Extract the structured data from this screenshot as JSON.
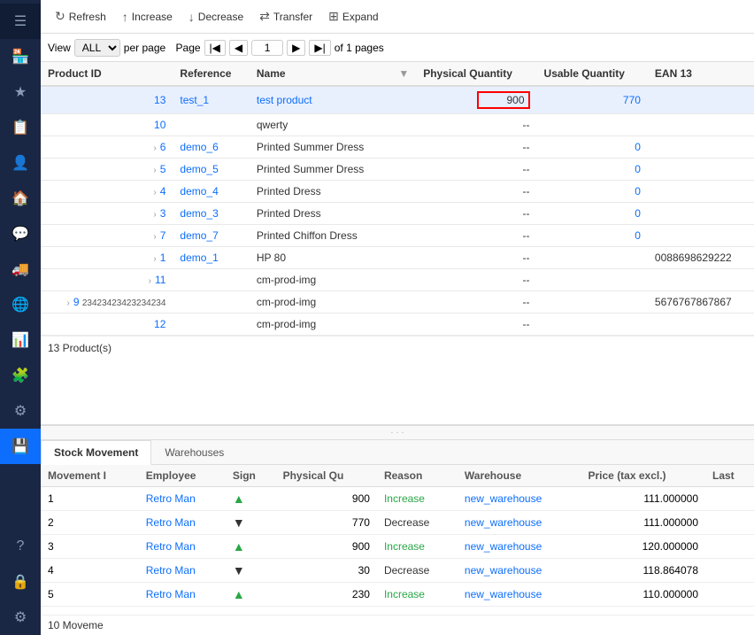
{
  "sidebar": {
    "items": [
      {
        "name": "menu-icon",
        "icon": "☰",
        "active": true
      },
      {
        "name": "store-icon",
        "icon": "🏪"
      },
      {
        "name": "star-icon",
        "icon": "★"
      },
      {
        "name": "clipboard-icon",
        "icon": "📋"
      },
      {
        "name": "user-icon",
        "icon": "👤"
      },
      {
        "name": "home-icon",
        "icon": "🏠"
      },
      {
        "name": "chat-icon",
        "icon": "💬"
      },
      {
        "name": "truck-icon",
        "icon": "🚚"
      },
      {
        "name": "globe-icon",
        "icon": "🌐"
      },
      {
        "name": "chart-icon",
        "icon": "📊"
      },
      {
        "name": "puzzle-icon",
        "icon": "🧩"
      },
      {
        "name": "settings2-icon",
        "icon": "⚙"
      },
      {
        "name": "storage-icon",
        "icon": "💾",
        "active": true
      },
      {
        "name": "help-icon",
        "icon": "?"
      },
      {
        "name": "lock-icon",
        "icon": "🔒"
      },
      {
        "name": "settings-icon",
        "icon": "⚙"
      }
    ]
  },
  "toolbar": {
    "refresh_label": "Refresh",
    "increase_label": "Increase",
    "decrease_label": "Decrease",
    "transfer_label": "Transfer",
    "expand_label": "Expand"
  },
  "pagination": {
    "view_label": "View",
    "per_page_label": "per page",
    "page_label": "Page",
    "of_label": "of 1 pages",
    "current_page": "1",
    "page_size": "ALL"
  },
  "table": {
    "columns": [
      "Product ID",
      "Reference",
      "Name",
      "",
      "Physical Quantity",
      "Usable Quantity",
      "EAN 13"
    ],
    "rows": [
      {
        "id": "13",
        "ref": "test_1",
        "name": "test product",
        "phys_qty": "900",
        "usable_qty": "770",
        "ean": "",
        "selected": true,
        "has_children": false,
        "highlight_phys": true
      },
      {
        "id": "10",
        "ref": "",
        "name": "qwerty",
        "phys_qty": "--",
        "usable_qty": "",
        "ean": "",
        "selected": false,
        "has_children": false
      },
      {
        "id": "6",
        "ref": "demo_6",
        "name": "Printed Summer Dress",
        "phys_qty": "--",
        "usable_qty": "0",
        "ean": "",
        "selected": false,
        "has_children": true
      },
      {
        "id": "5",
        "ref": "demo_5",
        "name": "Printed Summer Dress",
        "phys_qty": "--",
        "usable_qty": "0",
        "ean": "",
        "selected": false,
        "has_children": true
      },
      {
        "id": "4",
        "ref": "demo_4",
        "name": "Printed Dress",
        "phys_qty": "--",
        "usable_qty": "0",
        "ean": "",
        "selected": false,
        "has_children": true
      },
      {
        "id": "3",
        "ref": "demo_3",
        "name": "Printed Dress",
        "phys_qty": "--",
        "usable_qty": "0",
        "ean": "",
        "selected": false,
        "has_children": true
      },
      {
        "id": "7",
        "ref": "demo_7",
        "name": "Printed Chiffon Dress",
        "phys_qty": "--",
        "usable_qty": "0",
        "ean": "",
        "selected": false,
        "has_children": true
      },
      {
        "id": "1",
        "ref": "demo_1",
        "name": "HP 80",
        "phys_qty": "--",
        "usable_qty": "",
        "ean": "0088698629222",
        "selected": false,
        "has_children": true
      },
      {
        "id": "11",
        "ref": "",
        "name": "cm-prod-img",
        "phys_qty": "--",
        "usable_qty": "",
        "ean": "",
        "selected": false,
        "has_children": true
      },
      {
        "id": "9",
        "ref": "23423423423234234",
        "name": "cm-prod-img",
        "phys_qty": "--",
        "usable_qty": "",
        "ean": "5676767867867",
        "selected": false,
        "has_children": true
      },
      {
        "id": "12",
        "ref": "",
        "name": "cm-prod-img",
        "phys_qty": "--",
        "usable_qty": "",
        "ean": "",
        "selected": false,
        "has_children": false
      }
    ],
    "footer": "13 Product(s)"
  },
  "bottom_tabs": [
    "Stock Movement",
    "Warehouses"
  ],
  "active_tab": "Stock Movement",
  "movement_table": {
    "columns": [
      "Movement I",
      "Employee",
      "Sign",
      "Physical Qu",
      "Reason",
      "Warehouse",
      "Price (tax excl.)",
      "Last"
    ],
    "rows": [
      {
        "id": "1",
        "employee": "Retro Man",
        "sign": "up",
        "qty": "900",
        "reason": "Increase",
        "warehouse": "new_warehouse",
        "price": "111.000000"
      },
      {
        "id": "2",
        "employee": "Retro Man",
        "sign": "down",
        "qty": "770",
        "reason": "Decrease",
        "warehouse": "new_warehouse",
        "price": "111.000000"
      },
      {
        "id": "3",
        "employee": "Retro Man",
        "sign": "up",
        "qty": "900",
        "reason": "Increase",
        "warehouse": "new_warehouse",
        "price": "120.000000"
      },
      {
        "id": "4",
        "employee": "Retro Man",
        "sign": "down",
        "qty": "30",
        "reason": "Decrease",
        "warehouse": "new_warehouse",
        "price": "118.864078"
      },
      {
        "id": "5",
        "employee": "Retro Man",
        "sign": "up",
        "qty": "230",
        "reason": "Increase",
        "warehouse": "new_warehouse",
        "price": "110.000000"
      }
    ],
    "footer": "10 Moveme"
  }
}
